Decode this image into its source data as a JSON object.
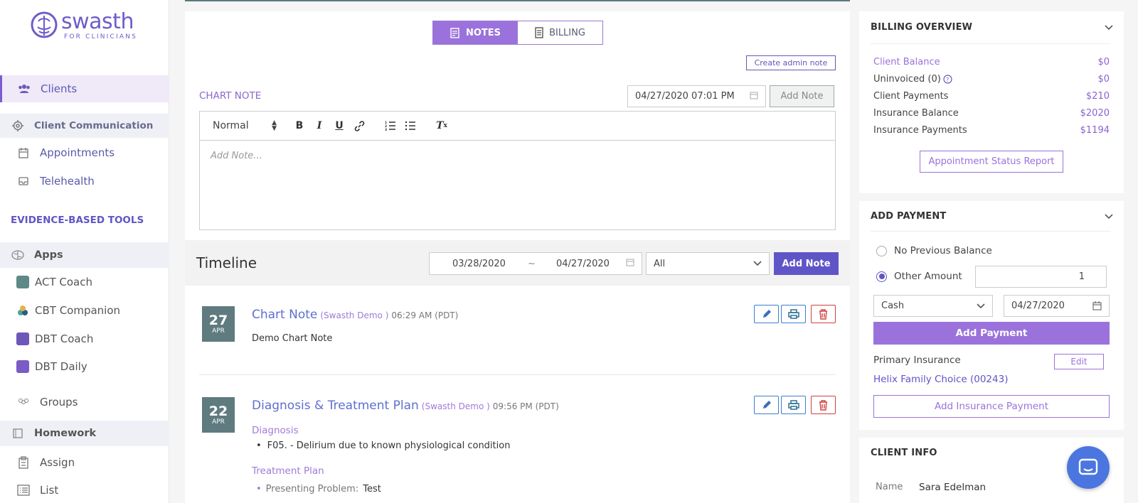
{
  "brand": {
    "name": "swasth",
    "tagline": "FOR CLINICIANS"
  },
  "sidebar": {
    "items": [
      {
        "label": "Clients",
        "icon": "users-icon"
      },
      {
        "label": "Client Communication",
        "icon": "gear-icon"
      },
      {
        "label": "Appointments",
        "icon": "calendar-icon"
      },
      {
        "label": "Telehealth",
        "icon": "inbox-icon"
      },
      {
        "label": "EVIDENCE-BASED TOOLS"
      },
      {
        "label": "Apps",
        "icon": "brain-icon"
      },
      {
        "label": "ACT Coach",
        "icon": "act-app-icon"
      },
      {
        "label": "CBT Companion",
        "icon": "cbt-app-icon"
      },
      {
        "label": "DBT Coach",
        "icon": "dbt-coach-app-icon"
      },
      {
        "label": "DBT Daily",
        "icon": "dbt-daily-app-icon"
      },
      {
        "label": "Groups",
        "icon": "groups-icon"
      },
      {
        "label": "Homework",
        "icon": "book-icon"
      },
      {
        "label": "Assign",
        "icon": "clipboard-icon"
      },
      {
        "label": "List",
        "icon": "list-icon"
      }
    ]
  },
  "tabs": {
    "notes": "NOTES",
    "billing": "BILLING"
  },
  "notes": {
    "create_admin": "Create admin note",
    "chart_note_label": "CHART NOTE",
    "datetime": "04/27/2020 07:01 PM",
    "add_note": "Add Note",
    "format": "Normal",
    "placeholder": "Add Note..."
  },
  "timeline": {
    "title": "Timeline",
    "from": "03/28/2020",
    "sep": "~",
    "to": "04/27/2020",
    "filter": "All",
    "add_note": "Add Note",
    "entries": [
      {
        "day": "27",
        "month": "APR",
        "title": "Chart Note",
        "author": "(Swasth Demo )",
        "time": "06:29 AM (PDT)",
        "body": "Demo Chart Note"
      },
      {
        "day": "22",
        "month": "APR",
        "title": "Diagnosis & Treatment Plan",
        "author": "(Swasth Demo )",
        "time": "09:56 PM (PDT)",
        "diagnosis_label": "Diagnosis",
        "diagnosis_item": "F05. - Delirium due to known physiological condition",
        "treatment_label": "Treatment Plan",
        "presenting_label": "Presenting Problem:",
        "presenting_value": "Test"
      }
    ]
  },
  "billing": {
    "title": "BILLING OVERVIEW",
    "rows": [
      {
        "label": "Client Balance",
        "value": "$0"
      },
      {
        "label": "Uninvoiced (0)",
        "value": "$0"
      },
      {
        "label": "Client Payments",
        "value": "$210"
      },
      {
        "label": "Insurance Balance",
        "value": "$2020"
      },
      {
        "label": "Insurance Payments",
        "value": "$1194"
      }
    ],
    "report_button": "Appointment Status Report"
  },
  "payment": {
    "title": "ADD PAYMENT",
    "opt1": "No Previous Balance",
    "opt2": "Other Amount",
    "amount": "1",
    "method": "Cash",
    "date": "04/27/2020",
    "add_button": "Add Payment",
    "primary_label": "Primary Insurance",
    "edit": "Edit",
    "insurer": "Helix Family Choice (00243)",
    "add_ins_button": "Add Insurance Payment"
  },
  "client_info": {
    "title": "CLIENT INFO",
    "name_label": "Name",
    "name_value": "Sara Edelman"
  },
  "colors": {
    "accent": "#6055c6",
    "purple": "#9b72dc",
    "badge": "#5f7b80"
  }
}
